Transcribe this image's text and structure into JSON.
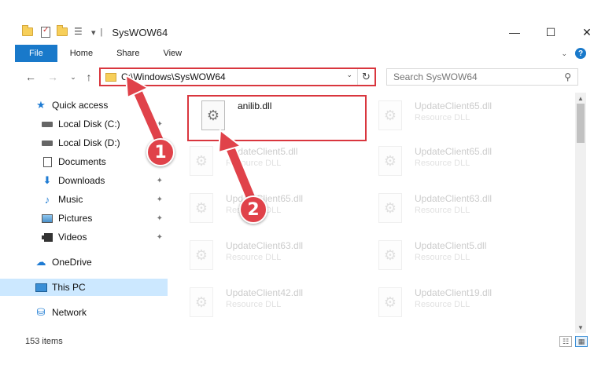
{
  "window": {
    "title": "SysWOW64",
    "minimize_glyph": "—",
    "maximize_glyph": "☐",
    "close_glyph": "✕"
  },
  "quick_access_toolbar": {
    "separator": "▾"
  },
  "ribbon": {
    "tabs": [
      {
        "label": "File"
      },
      {
        "label": "Home"
      },
      {
        "label": "Share"
      },
      {
        "label": "View"
      }
    ],
    "collapse_glyph": "⌄",
    "help_label": "?"
  },
  "navigation": {
    "back": "←",
    "forward": "→",
    "recent": "⌄",
    "up": "↑"
  },
  "address_bar": {
    "path": "C:\\Windows\\SysWOW64",
    "dropdown": "⌄",
    "refresh": "↻"
  },
  "search": {
    "placeholder": "Search SysWOW64",
    "icon": "⚲"
  },
  "nav_pane": {
    "items": [
      {
        "label": "Quick access",
        "icon": "star-icon",
        "pinned": false
      },
      {
        "label": "Local Disk (C:)",
        "icon": "drive-icon",
        "pinned": true
      },
      {
        "label": "Local Disk (D:)",
        "icon": "drive-icon",
        "pinned": false
      },
      {
        "label": "Documents",
        "icon": "document-icon",
        "pinned": true
      },
      {
        "label": "Downloads",
        "icon": "download-icon",
        "pinned": true
      },
      {
        "label": "Music",
        "icon": "music-icon",
        "pinned": true
      },
      {
        "label": "Pictures",
        "icon": "pictures-icon",
        "pinned": true
      },
      {
        "label": "Videos",
        "icon": "videos-icon",
        "pinned": true
      },
      {
        "label": "OneDrive",
        "icon": "cloud-icon",
        "pinned": false
      },
      {
        "label": "This PC",
        "icon": "pc-icon",
        "pinned": false,
        "selected": true
      },
      {
        "label": "Network",
        "icon": "network-icon",
        "pinned": false
      }
    ],
    "pin_glyph": "📌"
  },
  "files": [
    {
      "name": "anilib.dll",
      "type": "",
      "highlighted": true
    },
    {
      "name": "UpdateClient65.dll",
      "type": "Resource DLL"
    },
    {
      "name": "",
      "type": ""
    },
    {
      "name": "UpdateClient65.dll",
      "type": "Resource DLL"
    },
    {
      "name": "UpdateClient5.dll",
      "type": "Resource DLL"
    },
    {
      "name": "UpdateClient65.dll",
      "type": "Resource DLL"
    },
    {
      "name": "UpdateClient65.dll",
      "type": "Resource DLL"
    },
    {
      "name": "UpdateClient63.dll",
      "type": "Resource DLL"
    },
    {
      "name": "UpdateClient63.dll",
      "type": "Resource DLL"
    },
    {
      "name": "UpdateClient5.dll",
      "type": "Resource DLL"
    },
    {
      "name": "UpdateClient42.dll",
      "type": "Resource DLL"
    },
    {
      "name": "UpdateClient19.dll",
      "type": "Resource DLL"
    }
  ],
  "status_bar": {
    "item_count": "153 items"
  },
  "annotations": {
    "step1": "1",
    "step2": "2",
    "color": "#e0424a"
  },
  "colors": {
    "accent": "#1979ca",
    "highlight_border": "#d9363e",
    "selected_nav": "#cce8ff"
  }
}
